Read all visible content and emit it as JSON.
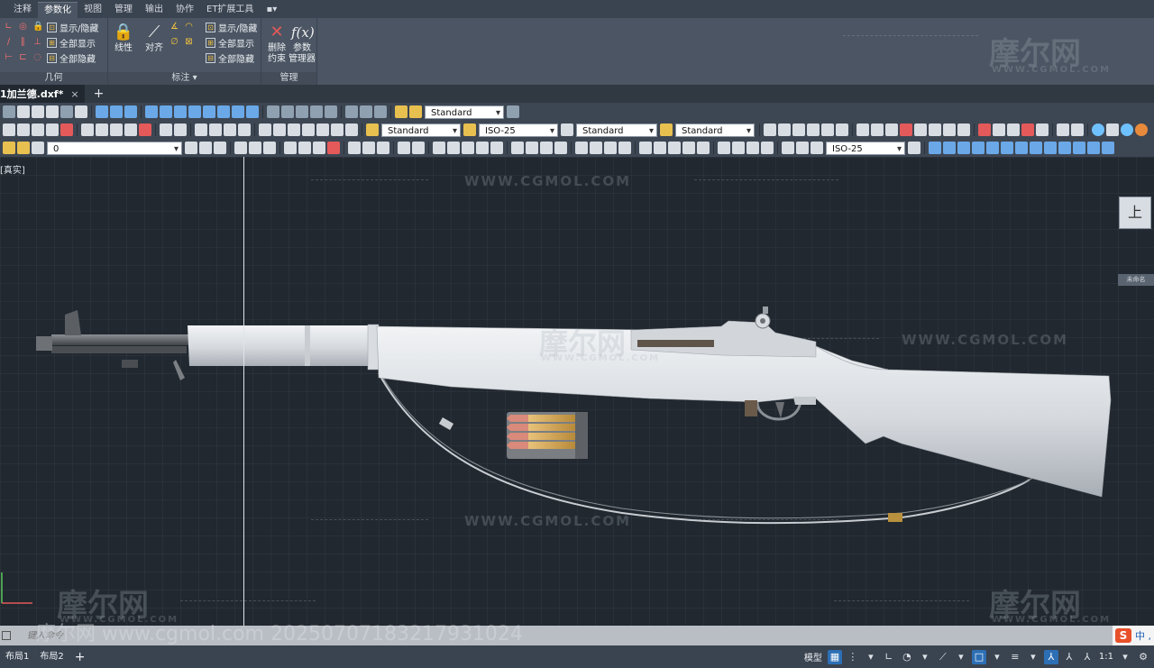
{
  "ribbon": {
    "tabs": [
      "注释",
      "参数化",
      "视图",
      "管理",
      "输出",
      "协作",
      "ET扩展工具"
    ],
    "active_tab": "参数化",
    "panels": {
      "geometry_title": "几何",
      "annotation_title": "标注",
      "manage_title": "管理"
    },
    "geometry_stack": [
      "显示/隐藏",
      "全部显示",
      "全部隐藏"
    ],
    "linear_label": "线性",
    "align_label": "对齐",
    "dim_stack": [
      "显示/隐藏",
      "全部显示",
      "全部隐藏"
    ],
    "delete_label_1": "删除",
    "delete_label_2": "约束",
    "params_icon": "f(x)",
    "params_label_1": "参数",
    "params_label_2": "管理器"
  },
  "watermark": {
    "logo": "摩尔网",
    "domain": "WWW.CGMOL.COM",
    "overlay": "摩尔网 www.cgmol.com 20250707183217931024"
  },
  "document": {
    "tab_label": "1加兰德.dxf*",
    "close_symbol": "×",
    "new_tab_symbol": "+"
  },
  "toolbars": {
    "text_style": "Standard",
    "text_style_2": "Standard",
    "dim_style": "ISO-25",
    "table_style": "Standard",
    "multileader_style": "Standard",
    "layer_name": "0",
    "dim_style_2": "ISO-25"
  },
  "canvas": {
    "viewport_label": "[真实]",
    "viewcube_face": "上",
    "wcs_label": "未命名"
  },
  "cmdline": {
    "placeholder": "键入命令",
    "ime_logo": "S",
    "ime_text": "中 ,"
  },
  "status": {
    "layout_tabs": [
      "布局1",
      "布局2"
    ],
    "add_layout": "+",
    "model_label": "模型",
    "scale": "1:1"
  },
  "colors": {
    "ribbon": "#4b5563",
    "canvas": "#212830",
    "accent": "#2d6fb5",
    "rifle_body": "#dde1e5",
    "rifle_metal": "#5b5f64"
  }
}
